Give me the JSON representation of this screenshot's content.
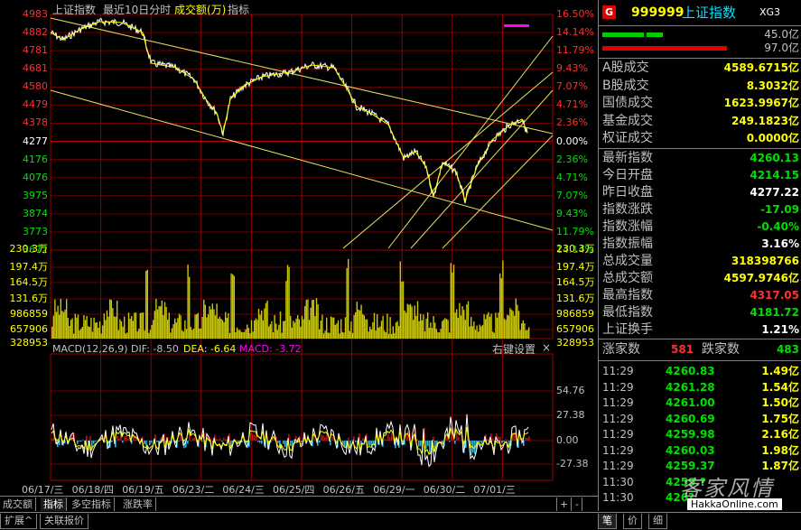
{
  "header": {
    "index_name": "上证指数",
    "period": "最近10日分时",
    "indicator": "成交额(万)",
    "menu": "指标"
  },
  "price_axis": {
    "left": [
      "4983",
      "4882",
      "4781",
      "4681",
      "4580",
      "4479",
      "4378",
      "4277",
      "4176",
      "4076",
      "3975",
      "3874",
      "3773",
      "3672"
    ],
    "right": [
      "16.50%",
      "14.14%",
      "11.79%",
      "9.43%",
      "7.07%",
      "4.71%",
      "2.36%",
      "0.00%",
      "2.36%",
      "4.71%",
      "7.07%",
      "9.43%",
      "11.79%",
      "14.14%"
    ]
  },
  "volume_axis": [
    "230.3万",
    "197.4万",
    "164.5万",
    "131.6万",
    "986859",
    "657906",
    "328953"
  ],
  "macd": {
    "label": "MACD(12,26,9)",
    "dif": "DIF: -8.50",
    "dea": "DEA: -6.64",
    "macd": "MACD: -3.72",
    "settings": "右键设置",
    "close": "×",
    "axis": [
      "54.76",
      "27.38",
      "0.00",
      "-27.38"
    ]
  },
  "dates": [
    "06/17/三",
    "06/18/四",
    "06/19/五",
    "06/23/二",
    "06/24/三",
    "06/25/四",
    "06/26/五",
    "06/29/一",
    "06/30/二",
    "07/01/三"
  ],
  "bottom_tabs": [
    "成交额",
    "指标",
    "多空指标",
    "涨跌率"
  ],
  "bottom_ctrl": [
    "+",
    "-"
  ],
  "footer_tabs": [
    "扩展^",
    "关联报价"
  ],
  "panel": {
    "badge": "G",
    "code": "999999",
    "name": "上证指数",
    "tag": "XG3",
    "bar1_value": "45.0亿",
    "bar2_value": "97.0亿",
    "stats": [
      {
        "label": "A股成交",
        "value": "4589.6715亿",
        "color": "#ffff00"
      },
      {
        "label": "B股成交",
        "value": "8.3032亿",
        "color": "#ffff00"
      },
      {
        "label": "国债成交",
        "value": "1623.9967亿",
        "color": "#ffff00"
      },
      {
        "label": "基金成交",
        "value": "249.1823亿",
        "color": "#ffff00"
      },
      {
        "label": "权证成交",
        "value": "0.0000亿",
        "color": "#ffff00"
      }
    ],
    "quotes": [
      {
        "label": "最新指数",
        "value": "4260.13",
        "color": "#00e000"
      },
      {
        "label": "今日开盘",
        "value": "4214.15",
        "color": "#00e000"
      },
      {
        "label": "昨日收盘",
        "value": "4277.22",
        "color": "#ffffff"
      },
      {
        "label": "指数涨跌",
        "value": "-17.09",
        "color": "#00e000"
      },
      {
        "label": "指数涨幅",
        "value": "-0.40%",
        "color": "#00e000"
      },
      {
        "label": "指数振幅",
        "value": "3.16%",
        "color": "#ffffff"
      },
      {
        "label": "总成交量",
        "value": "318398766",
        "color": "#ffff00"
      },
      {
        "label": "总成交额",
        "value": "4597.9746亿",
        "color": "#ffff00"
      },
      {
        "label": "最高指数",
        "value": "4317.05",
        "color": "#ff3030"
      },
      {
        "label": "最低指数",
        "value": "4181.72",
        "color": "#00e000"
      },
      {
        "label": "上证换手",
        "value": "1.21%",
        "color": "#ffffff"
      }
    ],
    "rise_label": "涨家数",
    "rise_value": "581",
    "fall_label": "跌家数",
    "fall_value": "483",
    "ticks": [
      {
        "time": "11:29",
        "price": "4260.83",
        "vol": "1.49亿"
      },
      {
        "time": "11:29",
        "price": "4261.28",
        "vol": "1.54亿"
      },
      {
        "time": "11:29",
        "price": "4261.00",
        "vol": "1.50亿"
      },
      {
        "time": "11:29",
        "price": "4260.69",
        "vol": "1.75亿"
      },
      {
        "time": "11:29",
        "price": "4259.98",
        "vol": "2.16亿"
      },
      {
        "time": "11:29",
        "price": "4260.03",
        "vol": "1.98亿"
      },
      {
        "time": "11:29",
        "price": "4259.37",
        "vol": "1.87亿"
      },
      {
        "time": "11:30",
        "price": "4259.?",
        "vol": ""
      },
      {
        "time": "11:30",
        "price": "426?",
        "vol": ""
      }
    ],
    "bottom_tabs": [
      "笔",
      "价",
      "细"
    ],
    "watermark": "客家风情",
    "watermark_url": "HakkaOnline.com"
  }
}
